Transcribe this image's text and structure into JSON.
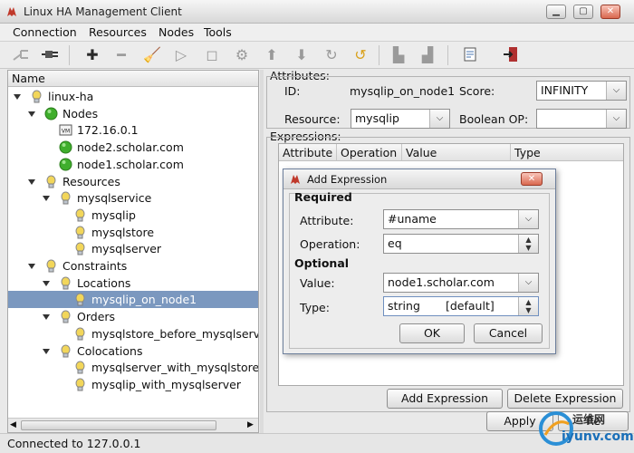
{
  "window": {
    "title": "Linux HA Management Client"
  },
  "menu": [
    "Connection",
    "Resources",
    "Nodes",
    "Tools"
  ],
  "toolbar": {
    "icons": [
      "disconnect-icon",
      "connect-icon",
      "add-icon",
      "remove-icon",
      "clean-icon",
      "start-icon",
      "stop-icon",
      "settings-icon",
      "move-up-icon",
      "move-down-icon",
      "redo-icon",
      "undo-icon",
      "lock-icon",
      "unlock-icon",
      "document-icon",
      "exit-icon"
    ]
  },
  "tree": {
    "header": "Name",
    "items": [
      {
        "label": "linux-ha",
        "icon": "bulb",
        "expanded": true,
        "level": 0
      },
      {
        "label": "Nodes",
        "icon": "green-dot",
        "expanded": true,
        "level": 1
      },
      {
        "label": "172.16.0.1",
        "icon": "vm-box",
        "level": 2
      },
      {
        "label": "node2.scholar.com",
        "icon": "green-dot",
        "level": 2
      },
      {
        "label": "node1.scholar.com",
        "icon": "green-dot",
        "level": 2
      },
      {
        "label": "Resources",
        "icon": "bulb",
        "expanded": true,
        "level": 1
      },
      {
        "label": "mysqlservice",
        "icon": "bulb",
        "expanded": true,
        "level": 2
      },
      {
        "label": "mysqlip",
        "icon": "bulb",
        "level": 3
      },
      {
        "label": "mysqlstore",
        "icon": "bulb",
        "level": 3
      },
      {
        "label": "mysqlserver",
        "icon": "bulb",
        "level": 3
      },
      {
        "label": "Constraints",
        "icon": "bulb",
        "expanded": true,
        "level": 1
      },
      {
        "label": "Locations",
        "icon": "bulb",
        "expanded": true,
        "level": 2
      },
      {
        "label": "mysqlip_on_node1",
        "icon": "bulb",
        "level": 3,
        "selected": true
      },
      {
        "label": "Orders",
        "icon": "bulb",
        "expanded": true,
        "level": 2
      },
      {
        "label": "mysqlstore_before_mysqlserv",
        "icon": "bulb",
        "level": 3
      },
      {
        "label": "Colocations",
        "icon": "bulb",
        "expanded": true,
        "level": 2
      },
      {
        "label": "mysqlserver_with_mysqlstore",
        "icon": "bulb",
        "level": 3
      },
      {
        "label": "mysqlip_with_mysqlserver",
        "icon": "bulb",
        "level": 3
      }
    ]
  },
  "attributes": {
    "group_label": "Attributes:",
    "id_label": "ID:",
    "id_value": "mysqlip_on_node1",
    "score_label": "Score:",
    "score_value": "INFINITY",
    "resource_label": "Resource:",
    "resource_value": "mysqlip",
    "boolean_label": "Boolean OP:",
    "boolean_value": ""
  },
  "expressions": {
    "group_label": "Expressions:",
    "columns": [
      "Attribute",
      "Operation",
      "Value",
      "Type"
    ],
    "add_button": "Add Expression",
    "delete_button": "Delete Expression"
  },
  "apply_button": "Apply",
  "revert_button": "Re",
  "dialog": {
    "title": "Add Expression",
    "required_label": "Required",
    "attribute_label": "Attribute:",
    "attribute_value": "#uname",
    "operation_label": "Operation:",
    "operation_value": "eq",
    "optional_label": "Optional",
    "value_label": "Value:",
    "value_value": "node1.scholar.com",
    "type_label": "Type:",
    "type_value": "string",
    "type_default": "[default]",
    "ok_button": "OK",
    "cancel_button": "Cancel"
  },
  "status": {
    "text": "Connected to 127.0.0.1"
  },
  "watermark": {
    "text": "iyunv.com",
    "cn": "运维网"
  },
  "colors": {
    "selection": "#7b98bf",
    "green_node": "#3fae2c",
    "bulb": "#e0c040"
  }
}
